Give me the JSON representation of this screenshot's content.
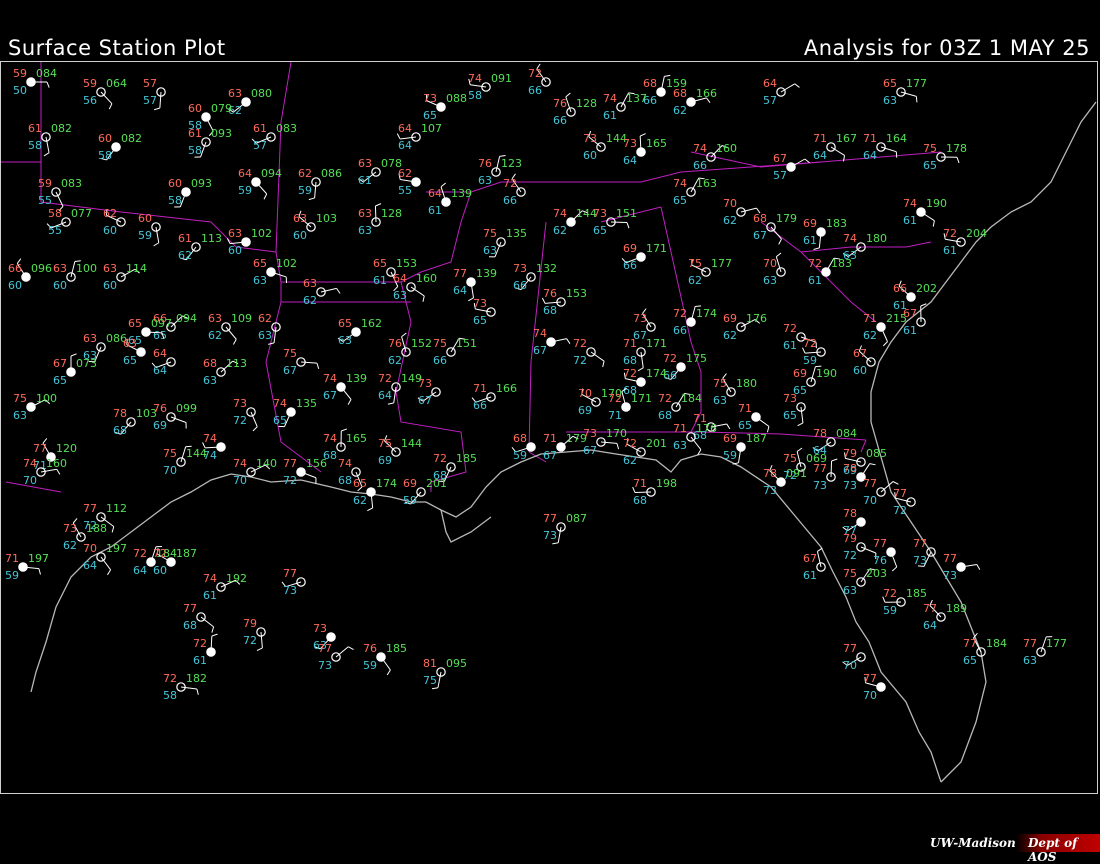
{
  "header": {
    "title": "Surface Station Plot",
    "analysis": "Analysis for 03Z  1 MAY 25"
  },
  "footer": {
    "org": "UW-Madison",
    "dept": "Dept of AOS"
  },
  "colors": {
    "background": "#000000",
    "temperature": "#ff6a5a",
    "dewpoint": "#45c6d8",
    "pressure": "#55e055",
    "state_borders": "#c020c0",
    "coastline": "#b8b8b8",
    "station_symbol": "#ffffff",
    "weather_symbol": "#ffff00"
  },
  "stations": [
    {
      "t": "59",
      "td": "50",
      "p": "084"
    },
    {
      "t": "59",
      "td": "56",
      "p": "064"
    },
    {
      "t": "57",
      "td": "57",
      "p": ""
    },
    {
      "t": "63",
      "td": "62",
      "p": "080"
    },
    {
      "t": "74",
      "td": "58",
      "p": "091"
    },
    {
      "t": "72",
      "td": "66",
      "p": ""
    },
    {
      "t": "68",
      "td": "66",
      "p": "159"
    },
    {
      "t": "64",
      "td": "57",
      "p": ""
    },
    {
      "t": "65",
      "td": "63",
      "p": "177"
    },
    {
      "t": "60",
      "td": "58",
      "p": "079"
    },
    {
      "t": "61",
      "td": "58",
      "p": "093"
    },
    {
      "t": "61",
      "td": "57",
      "p": "083"
    },
    {
      "t": "73",
      "td": "65",
      "p": "088"
    },
    {
      "t": "76",
      "td": "66",
      "p": "128"
    },
    {
      "t": "74",
      "td": "61",
      "p": "137"
    },
    {
      "t": "68",
      "td": "62",
      "p": "166"
    },
    {
      "t": "71",
      "td": "64",
      "p": "167"
    },
    {
      "t": "61",
      "td": "58",
      "p": "082"
    },
    {
      "t": "60",
      "td": "58",
      "p": "082"
    },
    {
      "t": "64",
      "td": "64",
      "p": "107"
    },
    {
      "t": "73",
      "td": "60",
      "p": "144"
    },
    {
      "t": "73",
      "td": "64",
      "p": "165"
    },
    {
      "t": "74",
      "td": "66",
      "p": "160"
    },
    {
      "t": "75",
      "td": "65",
      "p": "178"
    },
    {
      "t": "64",
      "td": "59",
      "p": "094"
    },
    {
      "t": "62",
      "td": "59",
      "p": "086"
    },
    {
      "t": "63",
      "td": "61",
      "p": "078"
    },
    {
      "t": "62",
      "td": "55",
      "p": ""
    },
    {
      "t": "72",
      "td": "66",
      "p": ""
    },
    {
      "t": "76",
      "td": "63",
      "p": "123"
    },
    {
      "t": "67",
      "td": "57",
      "p": ""
    },
    {
      "t": "71",
      "td": "64",
      "p": "164"
    },
    {
      "t": "59",
      "td": "55",
      "p": "083"
    },
    {
      "t": "60",
      "td": "58",
      "p": "093"
    },
    {
      "t": "58",
      "td": "55",
      "p": "077"
    },
    {
      "t": "62",
      "td": "60",
      "p": ""
    },
    {
      "t": "64",
      "td": "61",
      "p": "139"
    },
    {
      "t": "74",
      "td": "65",
      "p": "163"
    },
    {
      "t": "70",
      "td": "62",
      "p": ""
    },
    {
      "t": "74",
      "td": "61",
      "p": "190"
    },
    {
      "t": "60",
      "td": "59",
      "p": ""
    },
    {
      "t": "61",
      "td": "62",
      "p": "113"
    },
    {
      "t": "63",
      "td": "60",
      "p": "102"
    },
    {
      "t": "63",
      "td": "60",
      "p": "103"
    },
    {
      "t": "63",
      "td": "63",
      "p": "128"
    },
    {
      "t": "74",
      "td": "62",
      "p": "144"
    },
    {
      "t": "73",
      "td": "65",
      "p": "151"
    },
    {
      "t": "68",
      "td": "67",
      "p": "179"
    },
    {
      "t": "69",
      "td": "61",
      "p": "183"
    },
    {
      "t": "74",
      "td": "63",
      "p": "180"
    },
    {
      "t": "72",
      "td": "61",
      "p": "204"
    },
    {
      "t": "66",
      "td": "60",
      "p": "096"
    },
    {
      "t": "63",
      "td": "60",
      "p": "100"
    },
    {
      "t": "63",
      "td": "60",
      "p": "114"
    },
    {
      "t": "65",
      "td": "63",
      "p": "102"
    },
    {
      "t": "65",
      "td": "61",
      "p": "153"
    },
    {
      "t": "75",
      "td": "63",
      "p": "135"
    },
    {
      "t": "69",
      "td": "66",
      "p": "171"
    },
    {
      "t": "75",
      "td": "62",
      "p": "177"
    },
    {
      "t": "70",
      "td": "63",
      "p": ""
    },
    {
      "t": "72",
      "td": "61",
      "p": "183"
    },
    {
      "t": "63",
      "td": "62",
      "p": ""
    },
    {
      "t": "64",
      "td": "63",
      "p": "160"
    },
    {
      "t": "77",
      "td": "64",
      "p": "139"
    },
    {
      "t": "73",
      "td": "66",
      "p": "132"
    },
    {
      "t": "76",
      "td": "68",
      "p": "153"
    },
    {
      "t": "66",
      "td": "61",
      "p": "202"
    },
    {
      "t": "67",
      "td": "61",
      "p": ""
    },
    {
      "t": "66",
      "td": "65",
      "p": "094"
    },
    {
      "t": "65",
      "td": "65",
      "p": "097"
    },
    {
      "t": "63",
      "td": "62",
      "p": "109"
    },
    {
      "t": "62",
      "td": "63",
      "p": ""
    },
    {
      "t": "65",
      "td": "63",
      "p": "162"
    },
    {
      "t": "73",
      "td": "65",
      "p": ""
    },
    {
      "t": "73",
      "td": "67",
      "p": ""
    },
    {
      "t": "72",
      "td": "66",
      "p": "174"
    },
    {
      "t": "69",
      "td": "62",
      "p": "176"
    },
    {
      "t": "72",
      "td": "61",
      "p": ""
    },
    {
      "t": "71",
      "td": "62",
      "p": "215"
    },
    {
      "t": "63",
      "td": "63",
      "p": "086"
    },
    {
      "t": "64",
      "td": "64",
      "p": ""
    },
    {
      "t": "63",
      "td": "65",
      "p": ""
    },
    {
      "t": "76",
      "td": "62",
      "p": "152"
    },
    {
      "t": "75",
      "td": "66",
      "p": "151"
    },
    {
      "t": "74",
      "td": "67",
      "p": ""
    },
    {
      "t": "72",
      "td": "72",
      "p": ""
    },
    {
      "t": "71",
      "td": "68",
      "p": "171"
    },
    {
      "t": "72",
      "td": "66",
      "p": "175"
    },
    {
      "t": "72",
      "td": "59",
      "p": ""
    },
    {
      "t": "67",
      "td": "60",
      "p": ""
    },
    {
      "t": "67",
      "td": "65",
      "p": "073"
    },
    {
      "t": "68",
      "td": "63",
      "p": "113"
    },
    {
      "t": "75",
      "td": "67",
      "p": ""
    },
    {
      "t": "74",
      "td": "67",
      "p": "139"
    },
    {
      "t": "72",
      "td": "64",
      "p": "149"
    },
    {
      "t": "73",
      "td": "67",
      "p": ""
    },
    {
      "t": "72",
      "td": "68",
      "p": "174"
    },
    {
      "t": "75",
      "td": "63",
      "p": "180"
    },
    {
      "t": "69",
      "td": "65",
      "p": "190"
    },
    {
      "t": "75",
      "td": "63",
      "p": "100"
    },
    {
      "t": "76",
      "td": "69",
      "p": "099"
    },
    {
      "t": "73",
      "td": "72",
      "p": ""
    },
    {
      "t": "74",
      "td": "65",
      "p": "135"
    },
    {
      "t": "71",
      "td": "66",
      "p": "166"
    },
    {
      "t": "70",
      "td": "69",
      "p": "170"
    },
    {
      "t": "72",
      "td": "71",
      "p": "171"
    },
    {
      "t": "72",
      "td": "68",
      "p": "184"
    },
    {
      "t": "71",
      "td": "68",
      "p": ""
    },
    {
      "t": "71",
      "td": "65",
      "p": ""
    },
    {
      "t": "73",
      "td": "65",
      "p": ""
    },
    {
      "t": "78",
      "td": "68",
      "p": "103"
    },
    {
      "t": "74",
      "td": "74",
      "p": ""
    },
    {
      "t": "75",
      "td": "69",
      "p": "144"
    },
    {
      "t": "74",
      "td": "68",
      "p": "165"
    },
    {
      "t": "71",
      "td": "67",
      "p": "179"
    },
    {
      "t": "73",
      "td": "67",
      "p": "170"
    },
    {
      "t": "71",
      "td": "63",
      "p": "176"
    },
    {
      "t": "69",
      "td": "59",
      "p": "187"
    },
    {
      "t": "78",
      "td": "64",
      "p": "084"
    },
    {
      "t": "79",
      "td": "69",
      "p": "085"
    },
    {
      "t": "77",
      "td": "71",
      "p": "120"
    },
    {
      "t": "75",
      "td": "70",
      "p": "144"
    },
    {
      "t": "74",
      "td": "70",
      "p": "140"
    },
    {
      "t": "77",
      "td": "72",
      "p": "156"
    },
    {
      "t": "74",
      "td": "68",
      "p": ""
    },
    {
      "t": "72",
      "td": "68",
      "p": "185"
    },
    {
      "t": "68",
      "td": "59",
      "p": ""
    },
    {
      "t": "72",
      "td": "62",
      "p": "201"
    },
    {
      "t": "75",
      "td": "72",
      "p": "069"
    },
    {
      "t": "78",
      "td": "73",
      "p": ""
    },
    {
      "t": "74",
      "td": "70",
      "p": "160"
    },
    {
      "t": "77",
      "td": "72",
      "p": "112"
    },
    {
      "t": "65",
      "td": "62",
      "p": "174"
    },
    {
      "t": "69",
      "td": "59",
      "p": "201"
    },
    {
      "t": "71",
      "td": "68",
      "p": "198"
    },
    {
      "t": "78",
      "td": "73",
      "p": "091"
    },
    {
      "t": "77",
      "td": "73",
      "p": ""
    },
    {
      "t": "77",
      "td": "70",
      "p": ""
    },
    {
      "t": "71",
      "td": "59",
      "p": "197"
    },
    {
      "t": "70",
      "td": "64",
      "p": "197"
    },
    {
      "t": "77",
      "td": "73",
      "p": "087"
    },
    {
      "t": "78",
      "td": "77",
      "p": ""
    },
    {
      "t": "77",
      "td": "72",
      "p": ""
    },
    {
      "t": "73",
      "td": "62",
      "p": "188"
    },
    {
      "t": "72",
      "td": "64",
      "p": "184"
    },
    {
      "t": "74",
      "td": "61",
      "p": "192"
    },
    {
      "t": "79",
      "td": "72",
      "p": ""
    },
    {
      "t": "77",
      "td": "76",
      "p": ""
    },
    {
      "t": "77",
      "td": "73",
      "p": ""
    },
    {
      "t": "77",
      "td": "73",
      "p": ""
    },
    {
      "t": "72",
      "td": "60",
      "p": "187"
    },
    {
      "t": "67",
      "td": "61",
      "p": ""
    },
    {
      "t": "75",
      "td": "63",
      "p": "203"
    },
    {
      "t": "77",
      "td": "73",
      "p": ""
    },
    {
      "t": "77",
      "td": "68",
      "p": ""
    },
    {
      "t": "79",
      "td": "72",
      "p": ""
    },
    {
      "t": "73",
      "td": "63",
      "p": ""
    },
    {
      "t": "72",
      "td": "59",
      "p": "185"
    },
    {
      "t": "77",
      "td": "64",
      "p": "189"
    },
    {
      "t": "72",
      "td": "61",
      "p": ""
    },
    {
      "t": "77",
      "td": "73",
      "p": ""
    },
    {
      "t": "72",
      "td": "58",
      "p": "182"
    },
    {
      "t": "76",
      "td": "59",
      "p": "185"
    },
    {
      "t": "81",
      "td": "75",
      "p": "095"
    },
    {
      "t": "77",
      "td": "70",
      "p": ""
    },
    {
      "t": "77",
      "td": "70",
      "p": ""
    },
    {
      "t": "77",
      "td": "65",
      "p": "184"
    },
    {
      "t": "77",
      "td": "63",
      "p": "177"
    }
  ]
}
